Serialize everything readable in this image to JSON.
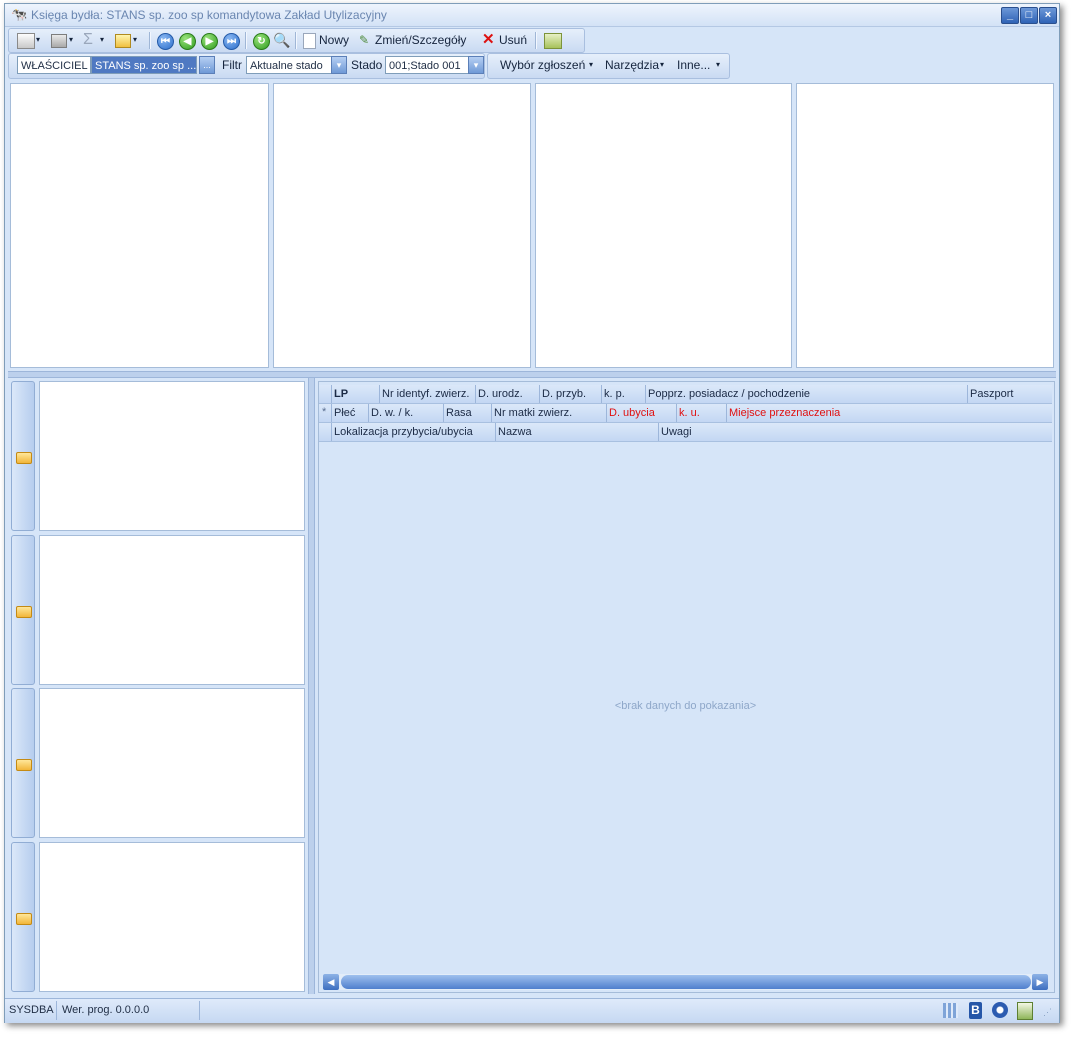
{
  "window": {
    "title": "Księga bydła: STANS sp. zoo sp komandytowa Zakład Utylizacyjny",
    "minimize": "_",
    "maximize": "□",
    "close": "×"
  },
  "toolbar1": {
    "new_label": "Nowy",
    "edit_label": "Zmień/Szczegóły",
    "delete_label": "Usuń"
  },
  "toolbar2": {
    "owner_label": "WŁAŚCICIEL",
    "owner_value": "STANS sp. zoo sp ...",
    "owner_btn": "...",
    "filter_label": "Filtr",
    "filter_value": "Aktualne stado",
    "herd_label": "Stado",
    "herd_value": "001;Stado 001",
    "menu_reports": "Wybór zgłoszeń",
    "menu_tools": "Narzędzia",
    "menu_other": "Inne...",
    "arrow": "▾"
  },
  "grid": {
    "row1": [
      "LP",
      "Nr identyf. zwierz.",
      "D. urodz.",
      "D. przyb.",
      "k. p.",
      "Popprz. posiadacz / pochodzenie",
      "Paszport"
    ],
    "row2": [
      "Płeć",
      "D. w. / k.",
      "Rasa",
      "Nr matki zwierz.",
      "D. ubycia",
      "k. u.",
      "Miejsce przeznaczenia"
    ],
    "row3": [
      "Lokalizacja przybycia/ubycia",
      "Nazwa",
      "Uwagi"
    ],
    "new_row_marker": "*",
    "empty_text": "<brak danych do pokazania>"
  },
  "status": {
    "user": "SYSDBA",
    "version": "Wer. prog. 0.0.0.0"
  },
  "colors": {
    "accent": "#d6e5f8",
    "header": "#c3d7f3",
    "highlight_red": "#e01010"
  }
}
